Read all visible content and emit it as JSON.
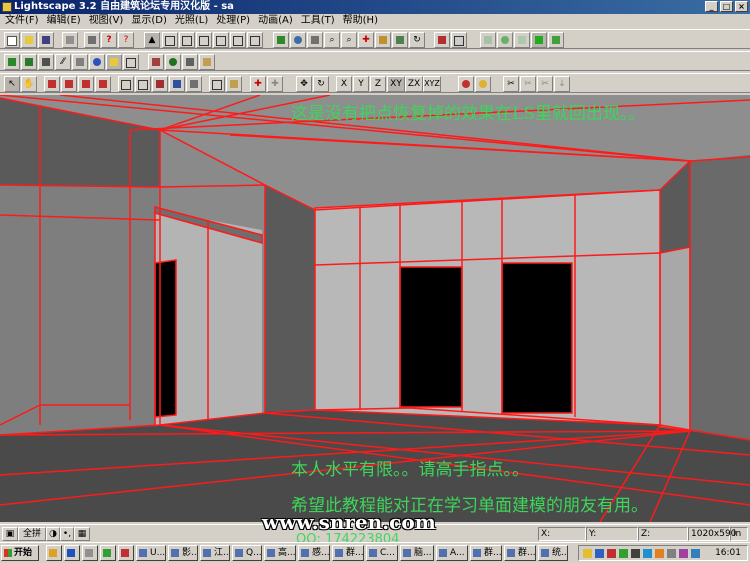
{
  "app": {
    "title": "Lightscape 3.2 自由建筑论坛专用汉化版 - sa"
  },
  "menu": [
    "文件(F)",
    "编辑(E)",
    "视图(V)",
    "显示(D)",
    "光照(L)",
    "处理(P)",
    "动画(A)",
    "工具(T)",
    "帮助(H)"
  ],
  "toolbar3_axes": [
    "X",
    "Y",
    "Z",
    "XY",
    "ZX",
    "XYZ"
  ],
  "captions": {
    "top": "这是没有把点恢复掉的效果在LS里就回出现。。",
    "middle": "本人水平有限。。请高手指点。。",
    "bottom": "希望此教程能对正在学习单面建模的朋友有用。"
  },
  "watermark": {
    "site": "www.snren.com",
    "qq": "QQ: 174223804"
  },
  "statusbar": {
    "mode_label": "全拼",
    "x": "X:",
    "y": "Y:",
    "z": "Z:",
    "resolution": "1020x590",
    "units": "in"
  },
  "taskbar": {
    "start": "开始",
    "tasks": [
      "U...",
      "影...",
      "江...",
      "Q...",
      "高...",
      "感...",
      "群...",
      "C...",
      "脑...",
      "A...",
      "群...",
      "群...",
      "统..."
    ],
    "clock": "16:01"
  },
  "colors": {
    "wireframe": "#ff1a1a",
    "caption": "#3cd65a",
    "titlebar": "#0a246a"
  }
}
